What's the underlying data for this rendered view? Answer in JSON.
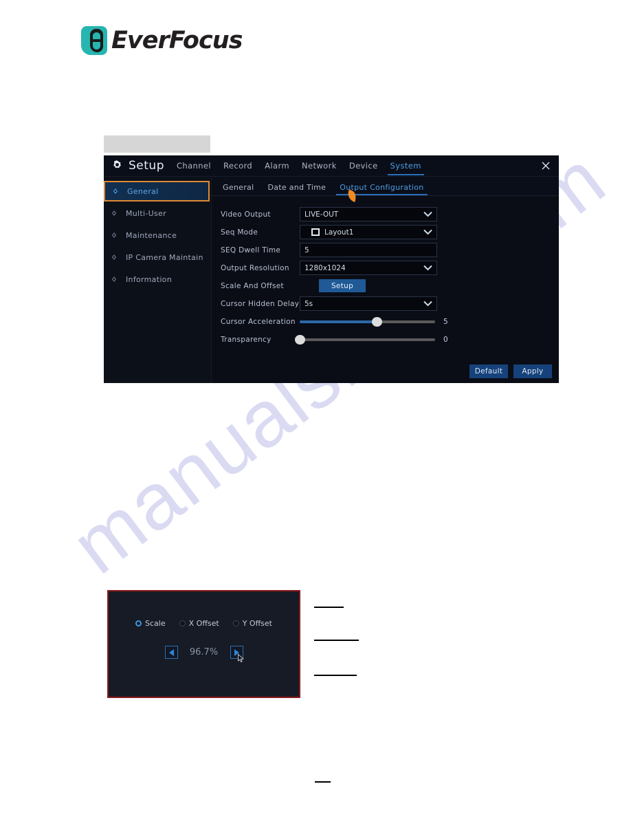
{
  "brand": {
    "logo_text": "EverFocus",
    "logo_mark": "f-logo-icon",
    "accent_teal": "#27b5b0"
  },
  "nvr_window": {
    "title": "Setup",
    "gear_icon": "gear-icon",
    "close_icon": "close-icon",
    "top_tabs": [
      {
        "label": "Channel",
        "active": false
      },
      {
        "label": "Record",
        "active": false
      },
      {
        "label": "Alarm",
        "active": false
      },
      {
        "label": "Network",
        "active": false
      },
      {
        "label": "Device",
        "active": false
      },
      {
        "label": "System",
        "active": true
      }
    ],
    "sub_tabs": [
      {
        "label": "General",
        "active": false
      },
      {
        "label": "Date and Time",
        "active": false
      },
      {
        "label": "Output Configuration",
        "active": true
      }
    ],
    "sidebar": {
      "items": [
        {
          "label": "General",
          "active": true
        },
        {
          "label": "Multi-User",
          "active": false
        },
        {
          "label": "Maintenance",
          "active": false
        },
        {
          "label": "IP Camera Maintain",
          "active": false
        },
        {
          "label": "Information",
          "active": false
        }
      ]
    },
    "form": {
      "video_output": {
        "label": "Video Output",
        "value": "LIVE-OUT"
      },
      "seq_mode": {
        "label": "Seq Mode",
        "value": "Layout1",
        "icon": "layout-square-icon"
      },
      "seq_dwell_time": {
        "label": "SEQ Dwell Time",
        "value": "5"
      },
      "output_resolution": {
        "label": "Output Resolution",
        "value": "1280x1024"
      },
      "scale_and_offset": {
        "label": "Scale And Offset",
        "button": "Setup"
      },
      "cursor_hidden_delay": {
        "label": "Cursor Hidden Delay",
        "value": "5s"
      },
      "cursor_acceleration": {
        "label": "Cursor Acceleration",
        "value": "5",
        "percent": 57
      },
      "transparency": {
        "label": "Transparency",
        "value": "0",
        "percent": 0
      }
    },
    "footer": {
      "default_label": "Default",
      "apply_label": "Apply"
    },
    "accent_blue": "#4d9fe8",
    "highlight_orange": "#e08a34"
  },
  "scale_dialog": {
    "radios": [
      {
        "label": "Scale",
        "selected": true
      },
      {
        "label": "X Offset",
        "selected": false
      },
      {
        "label": "Y Offset",
        "selected": false
      }
    ],
    "decrease_icon": "left-arrow-icon",
    "increase_icon": "right-arrow-icon",
    "value": "96.7%",
    "border_color": "#8b1a1a"
  },
  "watermark": {
    "text": "manualshive.com"
  }
}
